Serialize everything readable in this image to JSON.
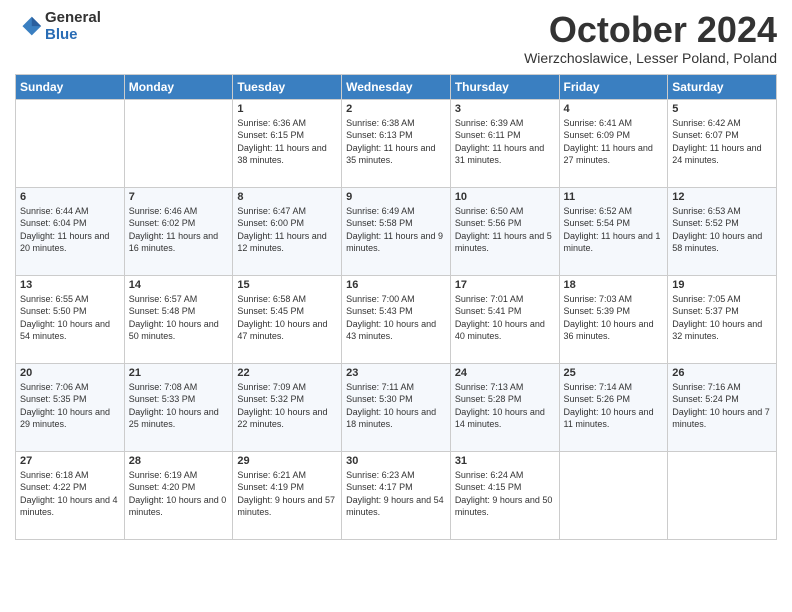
{
  "header": {
    "logo_general": "General",
    "logo_blue": "Blue",
    "month_title": "October 2024",
    "location": "Wierzchoslawice, Lesser Poland, Poland"
  },
  "days_of_week": [
    "Sunday",
    "Monday",
    "Tuesday",
    "Wednesday",
    "Thursday",
    "Friday",
    "Saturday"
  ],
  "weeks": [
    [
      {
        "num": "",
        "info": ""
      },
      {
        "num": "",
        "info": ""
      },
      {
        "num": "1",
        "info": "Sunrise: 6:36 AM\nSunset: 6:15 PM\nDaylight: 11 hours and 38 minutes."
      },
      {
        "num": "2",
        "info": "Sunrise: 6:38 AM\nSunset: 6:13 PM\nDaylight: 11 hours and 35 minutes."
      },
      {
        "num": "3",
        "info": "Sunrise: 6:39 AM\nSunset: 6:11 PM\nDaylight: 11 hours and 31 minutes."
      },
      {
        "num": "4",
        "info": "Sunrise: 6:41 AM\nSunset: 6:09 PM\nDaylight: 11 hours and 27 minutes."
      },
      {
        "num": "5",
        "info": "Sunrise: 6:42 AM\nSunset: 6:07 PM\nDaylight: 11 hours and 24 minutes."
      }
    ],
    [
      {
        "num": "6",
        "info": "Sunrise: 6:44 AM\nSunset: 6:04 PM\nDaylight: 11 hours and 20 minutes."
      },
      {
        "num": "7",
        "info": "Sunrise: 6:46 AM\nSunset: 6:02 PM\nDaylight: 11 hours and 16 minutes."
      },
      {
        "num": "8",
        "info": "Sunrise: 6:47 AM\nSunset: 6:00 PM\nDaylight: 11 hours and 12 minutes."
      },
      {
        "num": "9",
        "info": "Sunrise: 6:49 AM\nSunset: 5:58 PM\nDaylight: 11 hours and 9 minutes."
      },
      {
        "num": "10",
        "info": "Sunrise: 6:50 AM\nSunset: 5:56 PM\nDaylight: 11 hours and 5 minutes."
      },
      {
        "num": "11",
        "info": "Sunrise: 6:52 AM\nSunset: 5:54 PM\nDaylight: 11 hours and 1 minute."
      },
      {
        "num": "12",
        "info": "Sunrise: 6:53 AM\nSunset: 5:52 PM\nDaylight: 10 hours and 58 minutes."
      }
    ],
    [
      {
        "num": "13",
        "info": "Sunrise: 6:55 AM\nSunset: 5:50 PM\nDaylight: 10 hours and 54 minutes."
      },
      {
        "num": "14",
        "info": "Sunrise: 6:57 AM\nSunset: 5:48 PM\nDaylight: 10 hours and 50 minutes."
      },
      {
        "num": "15",
        "info": "Sunrise: 6:58 AM\nSunset: 5:45 PM\nDaylight: 10 hours and 47 minutes."
      },
      {
        "num": "16",
        "info": "Sunrise: 7:00 AM\nSunset: 5:43 PM\nDaylight: 10 hours and 43 minutes."
      },
      {
        "num": "17",
        "info": "Sunrise: 7:01 AM\nSunset: 5:41 PM\nDaylight: 10 hours and 40 minutes."
      },
      {
        "num": "18",
        "info": "Sunrise: 7:03 AM\nSunset: 5:39 PM\nDaylight: 10 hours and 36 minutes."
      },
      {
        "num": "19",
        "info": "Sunrise: 7:05 AM\nSunset: 5:37 PM\nDaylight: 10 hours and 32 minutes."
      }
    ],
    [
      {
        "num": "20",
        "info": "Sunrise: 7:06 AM\nSunset: 5:35 PM\nDaylight: 10 hours and 29 minutes."
      },
      {
        "num": "21",
        "info": "Sunrise: 7:08 AM\nSunset: 5:33 PM\nDaylight: 10 hours and 25 minutes."
      },
      {
        "num": "22",
        "info": "Sunrise: 7:09 AM\nSunset: 5:32 PM\nDaylight: 10 hours and 22 minutes."
      },
      {
        "num": "23",
        "info": "Sunrise: 7:11 AM\nSunset: 5:30 PM\nDaylight: 10 hours and 18 minutes."
      },
      {
        "num": "24",
        "info": "Sunrise: 7:13 AM\nSunset: 5:28 PM\nDaylight: 10 hours and 14 minutes."
      },
      {
        "num": "25",
        "info": "Sunrise: 7:14 AM\nSunset: 5:26 PM\nDaylight: 10 hours and 11 minutes."
      },
      {
        "num": "26",
        "info": "Sunrise: 7:16 AM\nSunset: 5:24 PM\nDaylight: 10 hours and 7 minutes."
      }
    ],
    [
      {
        "num": "27",
        "info": "Sunrise: 6:18 AM\nSunset: 4:22 PM\nDaylight: 10 hours and 4 minutes."
      },
      {
        "num": "28",
        "info": "Sunrise: 6:19 AM\nSunset: 4:20 PM\nDaylight: 10 hours and 0 minutes."
      },
      {
        "num": "29",
        "info": "Sunrise: 6:21 AM\nSunset: 4:19 PM\nDaylight: 9 hours and 57 minutes."
      },
      {
        "num": "30",
        "info": "Sunrise: 6:23 AM\nSunset: 4:17 PM\nDaylight: 9 hours and 54 minutes."
      },
      {
        "num": "31",
        "info": "Sunrise: 6:24 AM\nSunset: 4:15 PM\nDaylight: 9 hours and 50 minutes."
      },
      {
        "num": "",
        "info": ""
      },
      {
        "num": "",
        "info": ""
      }
    ]
  ]
}
